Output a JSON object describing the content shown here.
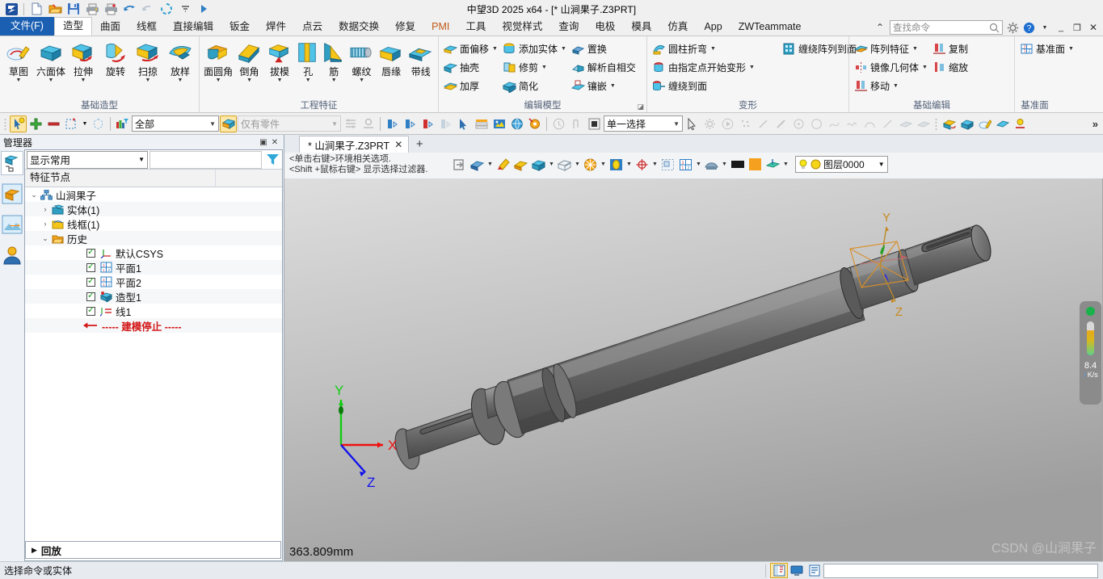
{
  "window": {
    "title": "中望3D 2025 x64 - [* 山涧果子.Z3PRT]",
    "minimize": "_",
    "restore": "❐",
    "close": "✕"
  },
  "quick_access": [
    {
      "name": "app-logo-icon",
      "label": "ZW"
    },
    {
      "name": "new-file-icon",
      "label": "新建"
    },
    {
      "name": "open-file-icon",
      "label": "打开"
    },
    {
      "name": "save-icon",
      "label": "保存"
    },
    {
      "name": "print-icon",
      "label": "打印"
    },
    {
      "name": "print-add-icon",
      "label": "打印预览"
    },
    {
      "name": "undo-icon",
      "label": "撤销"
    },
    {
      "name": "redo-icon",
      "label": "重做"
    },
    {
      "name": "regen-icon",
      "label": "重生成"
    },
    {
      "name": "customize-qat-icon",
      "label": "自定义"
    },
    {
      "name": "run-icon",
      "label": "运行"
    }
  ],
  "menu": {
    "file_tab": "文件(F)",
    "tabs": [
      {
        "label": "造型",
        "active": true
      },
      {
        "label": "曲面",
        "active": false
      },
      {
        "label": "线框",
        "active": false
      },
      {
        "label": "直接编辑",
        "active": false
      },
      {
        "label": "钣金",
        "active": false
      },
      {
        "label": "焊件",
        "active": false
      },
      {
        "label": "点云",
        "active": false
      },
      {
        "label": "数据交换",
        "active": false
      },
      {
        "label": "修复",
        "active": false
      },
      {
        "label": "PMI",
        "active": false,
        "accent": true
      },
      {
        "label": "工具",
        "active": false
      },
      {
        "label": "视觉样式",
        "active": false
      },
      {
        "label": "查询",
        "active": false
      },
      {
        "label": "电极",
        "active": false
      },
      {
        "label": "模具",
        "active": false
      },
      {
        "label": "仿真",
        "active": false
      },
      {
        "label": "App",
        "active": false
      },
      {
        "label": "ZWTeammate",
        "active": false
      }
    ],
    "collapse_icon": "⌃",
    "search_placeholder": "查找命令",
    "search_value": "",
    "search_icon": "search-icon",
    "settings_icon": "gear-icon",
    "help_icon": "help-icon"
  },
  "ribbon": {
    "groups": [
      {
        "title": "基础造型",
        "type": "big",
        "items": [
          {
            "label": "草图",
            "icon": "sketch-icon",
            "caret": true
          },
          {
            "label": "六面体",
            "icon": "box-icon",
            "caret": true
          },
          {
            "label": "拉伸",
            "icon": "extrude-icon",
            "caret": true
          },
          {
            "label": "旋转",
            "icon": "revolve-icon",
            "caret": false
          },
          {
            "label": "扫掠",
            "icon": "sweep-icon",
            "caret": true
          },
          {
            "label": "放样",
            "icon": "loft-icon",
            "caret": true
          }
        ]
      },
      {
        "title": "工程特征",
        "type": "big",
        "items": [
          {
            "label": "面圆角",
            "icon": "fillet-icon",
            "caret": true
          },
          {
            "label": "倒角",
            "icon": "chamfer-icon",
            "caret": true
          },
          {
            "label": "拔模",
            "icon": "draft-icon",
            "caret": true
          },
          {
            "label": "孔",
            "icon": "hole-icon",
            "caret": true
          },
          {
            "label": "筋",
            "icon": "rib-icon",
            "caret": true
          },
          {
            "label": "螺纹",
            "icon": "thread-icon",
            "caret": true
          },
          {
            "label": "唇缘",
            "icon": "lip-icon",
            "caret": false
          },
          {
            "label": "带线",
            "icon": "band-icon",
            "caret": false
          }
        ]
      },
      {
        "title": "编辑模型",
        "type": "small",
        "launcher": true,
        "columns": [
          [
            {
              "label": "面偏移",
              "icon": "face-offset-icon",
              "caret": true
            },
            {
              "label": "抽壳",
              "icon": "shell-icon",
              "caret": false
            },
            {
              "label": "加厚",
              "icon": "thicken-icon",
              "caret": false
            }
          ],
          [
            {
              "label": "添加实体",
              "icon": "add-solid-icon",
              "caret": true
            },
            {
              "label": "修剪",
              "icon": "trim-icon",
              "caret": true
            },
            {
              "label": "简化",
              "icon": "simplify-icon",
              "caret": false
            }
          ],
          [
            {
              "label": "置换",
              "icon": "replace-icon",
              "caret": false
            },
            {
              "label": "解析自相交",
              "icon": "self-intersect-icon",
              "caret": false
            },
            {
              "label": "镶嵌",
              "icon": "inlay-icon",
              "caret": true
            }
          ]
        ]
      },
      {
        "title": "变形",
        "type": "small",
        "columns": [
          [
            {
              "label": "圆柱折弯",
              "icon": "cylindrical-bend-icon",
              "caret": true
            },
            {
              "label": "由指定点开始变形",
              "icon": "point-deform-icon",
              "caret": true
            },
            {
              "label": "缠绕到面",
              "icon": "wrap-to-face-icon",
              "caret": false
            }
          ],
          [
            {
              "label": "缠绕阵列到面",
              "icon": "wrap-pattern-icon",
              "caret": false
            }
          ]
        ]
      },
      {
        "title": "基础编辑",
        "type": "small",
        "columns": [
          [
            {
              "label": "阵列特征",
              "icon": "pattern-feature-icon",
              "caret": true
            },
            {
              "label": "镜像几何体",
              "icon": "mirror-geometry-icon",
              "caret": true
            },
            {
              "label": "移动",
              "icon": "move-icon",
              "caret": true
            }
          ],
          [
            {
              "label": "复制",
              "icon": "copy-icon",
              "caret": false
            },
            {
              "label": "缩放",
              "icon": "scale-icon",
              "caret": false
            }
          ]
        ]
      },
      {
        "title": "基准面",
        "type": "small",
        "columns": [
          [
            {
              "label": "基准面",
              "icon": "datum-plane-icon",
              "caret": true
            }
          ]
        ]
      }
    ]
  },
  "toolbar2": {
    "visibility_filter": {
      "value": "全部",
      "name": "visibility-filter-combo"
    },
    "part_filter": {
      "value": "仅有零件",
      "name": "part-filter-combo",
      "disabled": true
    },
    "selection_mode": {
      "value": "单一选择",
      "name": "selection-mode-combo"
    },
    "overflow_icon": "»",
    "icons": [
      "pick-highlight-icon",
      "add-icon",
      "remove-icon",
      "select-box-icon",
      "select-circle-icon",
      "filter-color-icon",
      "layer-visibility-icon"
    ],
    "icons2": [
      "align-icon",
      "measure-icon",
      "entity-filter-1-icon",
      "entity-filter-2-icon",
      "entity-filter-3-icon",
      "entity-filter-4-icon",
      "cursor-icon",
      "stack-icon",
      "image-icon",
      "globe-icon",
      "pick-settings-icon",
      "clock-icon",
      "curve-icon",
      "solid-icon"
    ],
    "icons3": [
      "arrow-icon",
      "gear-grey-icon",
      "play-icon",
      "points-icon",
      "line-icon",
      "line2-icon",
      "circle-center-icon",
      "circle-icon",
      "spline-icon",
      "wave-icon",
      "arc-icon",
      "slash-icon",
      "surface1-icon",
      "surface2-icon"
    ],
    "icons4": [
      "shape-red-icon",
      "shape-blue-icon",
      "sketch2-icon",
      "surface3-icon",
      "light-icon"
    ]
  },
  "manager": {
    "title": "管理器",
    "restore_icon": "▣",
    "close_icon": "✕",
    "rail": [
      {
        "name": "rail-feature-tree",
        "active": true
      },
      {
        "name": "rail-assembly",
        "active": false
      },
      {
        "name": "rail-image",
        "active": false
      },
      {
        "name": "rail-user",
        "active": false
      }
    ],
    "filter_combo": "显示常用",
    "filter_input": "",
    "filter_icon": "funnel-icon",
    "column_header": "特征节点",
    "tree": [
      {
        "label": "山涧果子",
        "depth": 0,
        "expander": "v",
        "icon": "part-root-icon",
        "checkbox": false
      },
      {
        "label": "实体(1)",
        "depth": 1,
        "expander": ">",
        "icon": "shape-folder-icon",
        "checkbox": false
      },
      {
        "label": "线框(1)",
        "depth": 1,
        "expander": ">",
        "icon": "wireframe-folder-icon",
        "checkbox": false
      },
      {
        "label": "历史",
        "depth": 1,
        "expander": "v",
        "icon": "history-folder-icon",
        "checkbox": false
      },
      {
        "label": "默认CSYS",
        "depth": 2,
        "expander": "",
        "icon": "csys-icon",
        "checkbox": true
      },
      {
        "label": "平面1",
        "depth": 2,
        "expander": "",
        "icon": "datum-plane-icon",
        "checkbox": true
      },
      {
        "label": "平面2",
        "depth": 2,
        "expander": "",
        "icon": "datum-plane-icon",
        "checkbox": true
      },
      {
        "label": "造型1",
        "depth": 2,
        "expander": "",
        "icon": "feature-shape-icon",
        "checkbox": true
      },
      {
        "label": "线1",
        "depth": 2,
        "expander": "",
        "icon": "curve-feature-icon",
        "checkbox": true
      },
      {
        "label": "----- 建模停止 -----",
        "depth": 2,
        "expander": "",
        "icon": "rollback-arrow-icon",
        "checkbox": false,
        "stop": true
      }
    ],
    "playback": {
      "label": "回放",
      "arrow": "▶"
    }
  },
  "document": {
    "tab_label": "* 山涧果子.Z3PRT",
    "tab_close": "✕",
    "new_tab": "+"
  },
  "viewport": {
    "hint_line1": "<单击右键>环境相关选项.",
    "hint_line2": "<Shift +鼠标右键> 显示选择过滤器.",
    "toolbar_icons": [
      {
        "name": "exit-icon",
        "caret": false
      },
      {
        "name": "shade-icon",
        "caret": true
      },
      {
        "name": "eraser-icon",
        "caret": false
      },
      {
        "name": "face-color-icon",
        "caret": false
      },
      {
        "name": "render-solid-icon",
        "caret": true
      },
      {
        "name": "wireframe-view-icon",
        "caret": true
      },
      {
        "name": "section-icon",
        "caret": true
      },
      {
        "name": "zoom-window-icon",
        "caret": true
      },
      {
        "name": "orient-icon",
        "caret": true
      },
      {
        "name": "view-tool-icon",
        "caret": false
      },
      {
        "name": "datum-view-icon",
        "caret": true
      },
      {
        "name": "display-mode-icon",
        "caret": true
      }
    ],
    "swatch_black": "#1a1a1a",
    "swatch_orange": "#f5a01e",
    "layer_dropdown": {
      "bulb_icon": "bulb-icon",
      "circle_icon": "layer-color-icon",
      "value": "图层0000"
    },
    "dimension_readout": "363.809mm",
    "watermark": "CSDN @山涧果子",
    "triad": {
      "x": "X",
      "y": "Y",
      "z": "Z",
      "x_color": "#ee1111",
      "y_color": "#11cc11",
      "z_color": "#1111ee"
    },
    "model_triad": {
      "y": "Y",
      "z": "Z",
      "label_color": "#c88a1f"
    },
    "network_widget": {
      "rate": "8.4",
      "unit": "K/s",
      "arrow": "↑"
    }
  },
  "statusbar": {
    "message": "选择命令或实体",
    "icons": [
      {
        "name": "status-panel-icon",
        "selected": true
      },
      {
        "name": "status-monitor-icon",
        "selected": false
      },
      {
        "name": "status-list-icon",
        "selected": false
      }
    ],
    "command_input": ""
  }
}
